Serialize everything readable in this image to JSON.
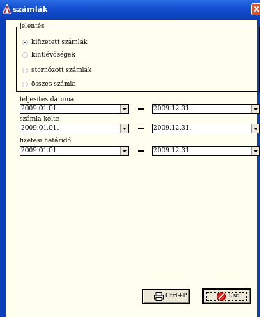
{
  "window": {
    "title": "számlák",
    "close_label": "X"
  },
  "display_group": {
    "legend": "jelentés",
    "options": [
      {
        "label": "kifizetett számlák",
        "checked": true
      },
      {
        "label": "kintlévőségek",
        "checked": false
      },
      {
        "label": "stornózott számlák",
        "checked": false
      },
      {
        "label": "összes számla",
        "checked": false
      }
    ]
  },
  "ranges": [
    {
      "label": "teljesítés dátuma",
      "from": "2009.01.01.",
      "to": "2009.12.31."
    },
    {
      "label": "számla kelte",
      "from": "2009.01.01.",
      "to": "2009.12.31."
    },
    {
      "label": "fizetési határidő",
      "from": "2009.01.01.",
      "to": "2009.12.31."
    }
  ],
  "buttons": {
    "print_label": "Ctrl+P",
    "exit_label": "Esc"
  },
  "colors": {
    "background": "#FFFFEF",
    "titlebar": "#0A3FB8",
    "close": "#D9532C"
  }
}
